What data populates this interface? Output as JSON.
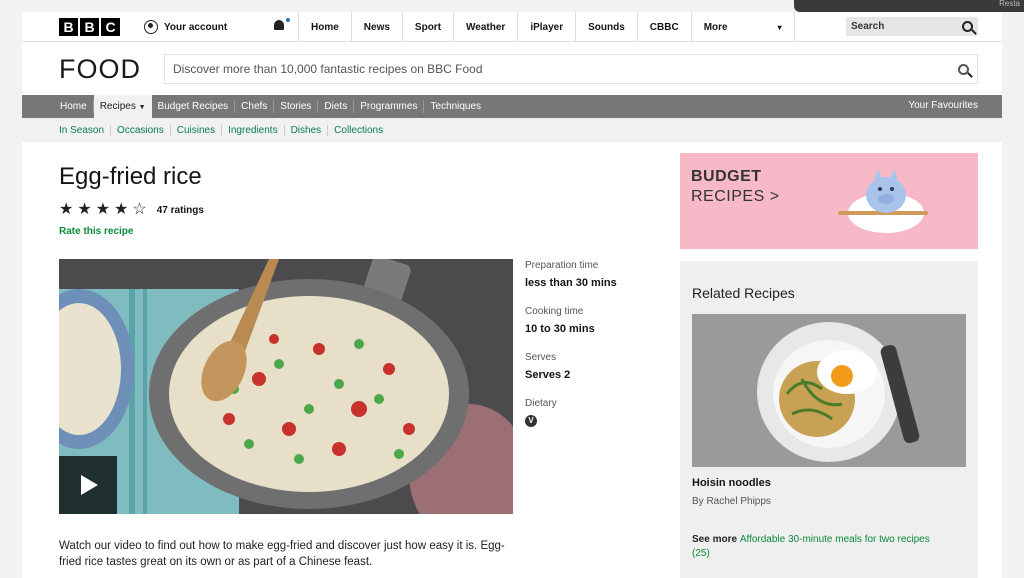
{
  "corner": {
    "label": "Resta"
  },
  "global_nav": {
    "logo_letters": [
      "B",
      "B",
      "C"
    ],
    "account": "Your account",
    "items": [
      "Home",
      "News",
      "Sport",
      "Weather",
      "iPlayer",
      "Sounds",
      "CBBC"
    ],
    "more": "More",
    "search_label": "Search"
  },
  "food_header": {
    "logo": "FOOD",
    "search_placeholder": "Discover more than 10,000 fantastic recipes on BBC Food"
  },
  "food_nav": {
    "items": [
      "Home",
      "Recipes",
      "Budget Recipes",
      "Chefs",
      "Stories",
      "Diets",
      "Programmes",
      "Techniques"
    ],
    "active_index": 1,
    "favourites": "Your Favourites"
  },
  "sub_nav": {
    "items": [
      "In Season",
      "Occasions",
      "Cuisines",
      "Ingredients",
      "Dishes",
      "Collections"
    ]
  },
  "recipe": {
    "title": "Egg-fried rice",
    "rating_value": 4,
    "rating_max": 5,
    "ratings_count": "47 ratings",
    "rate_link": "Rate this recipe",
    "facts": [
      {
        "label": "Preparation time",
        "value": "less than 30 mins"
      },
      {
        "label": "Cooking time",
        "value": "10 to 30 mins"
      },
      {
        "label": "Serves",
        "value": "Serves 2"
      },
      {
        "label": "Dietary",
        "value": "V"
      }
    ],
    "description": "Watch our video to find out how to make egg-fried and discover just how easy it is. Egg-fried rice tastes great on its own or as part of a Chinese feast."
  },
  "promo": {
    "line1": "BUDGET",
    "line2": "RECIPES >",
    "color": "#f7b9c8"
  },
  "related": {
    "heading": "Related Recipes",
    "item_title": "Hoisin noodles",
    "item_author": "By Rachel Phipps",
    "see_more_prefix": "See more",
    "see_more_link": "Affordable 30-minute meals for two recipes (25)"
  },
  "colors": {
    "accent_green": "#0a8a3a",
    "nav_grey": "#777777"
  }
}
